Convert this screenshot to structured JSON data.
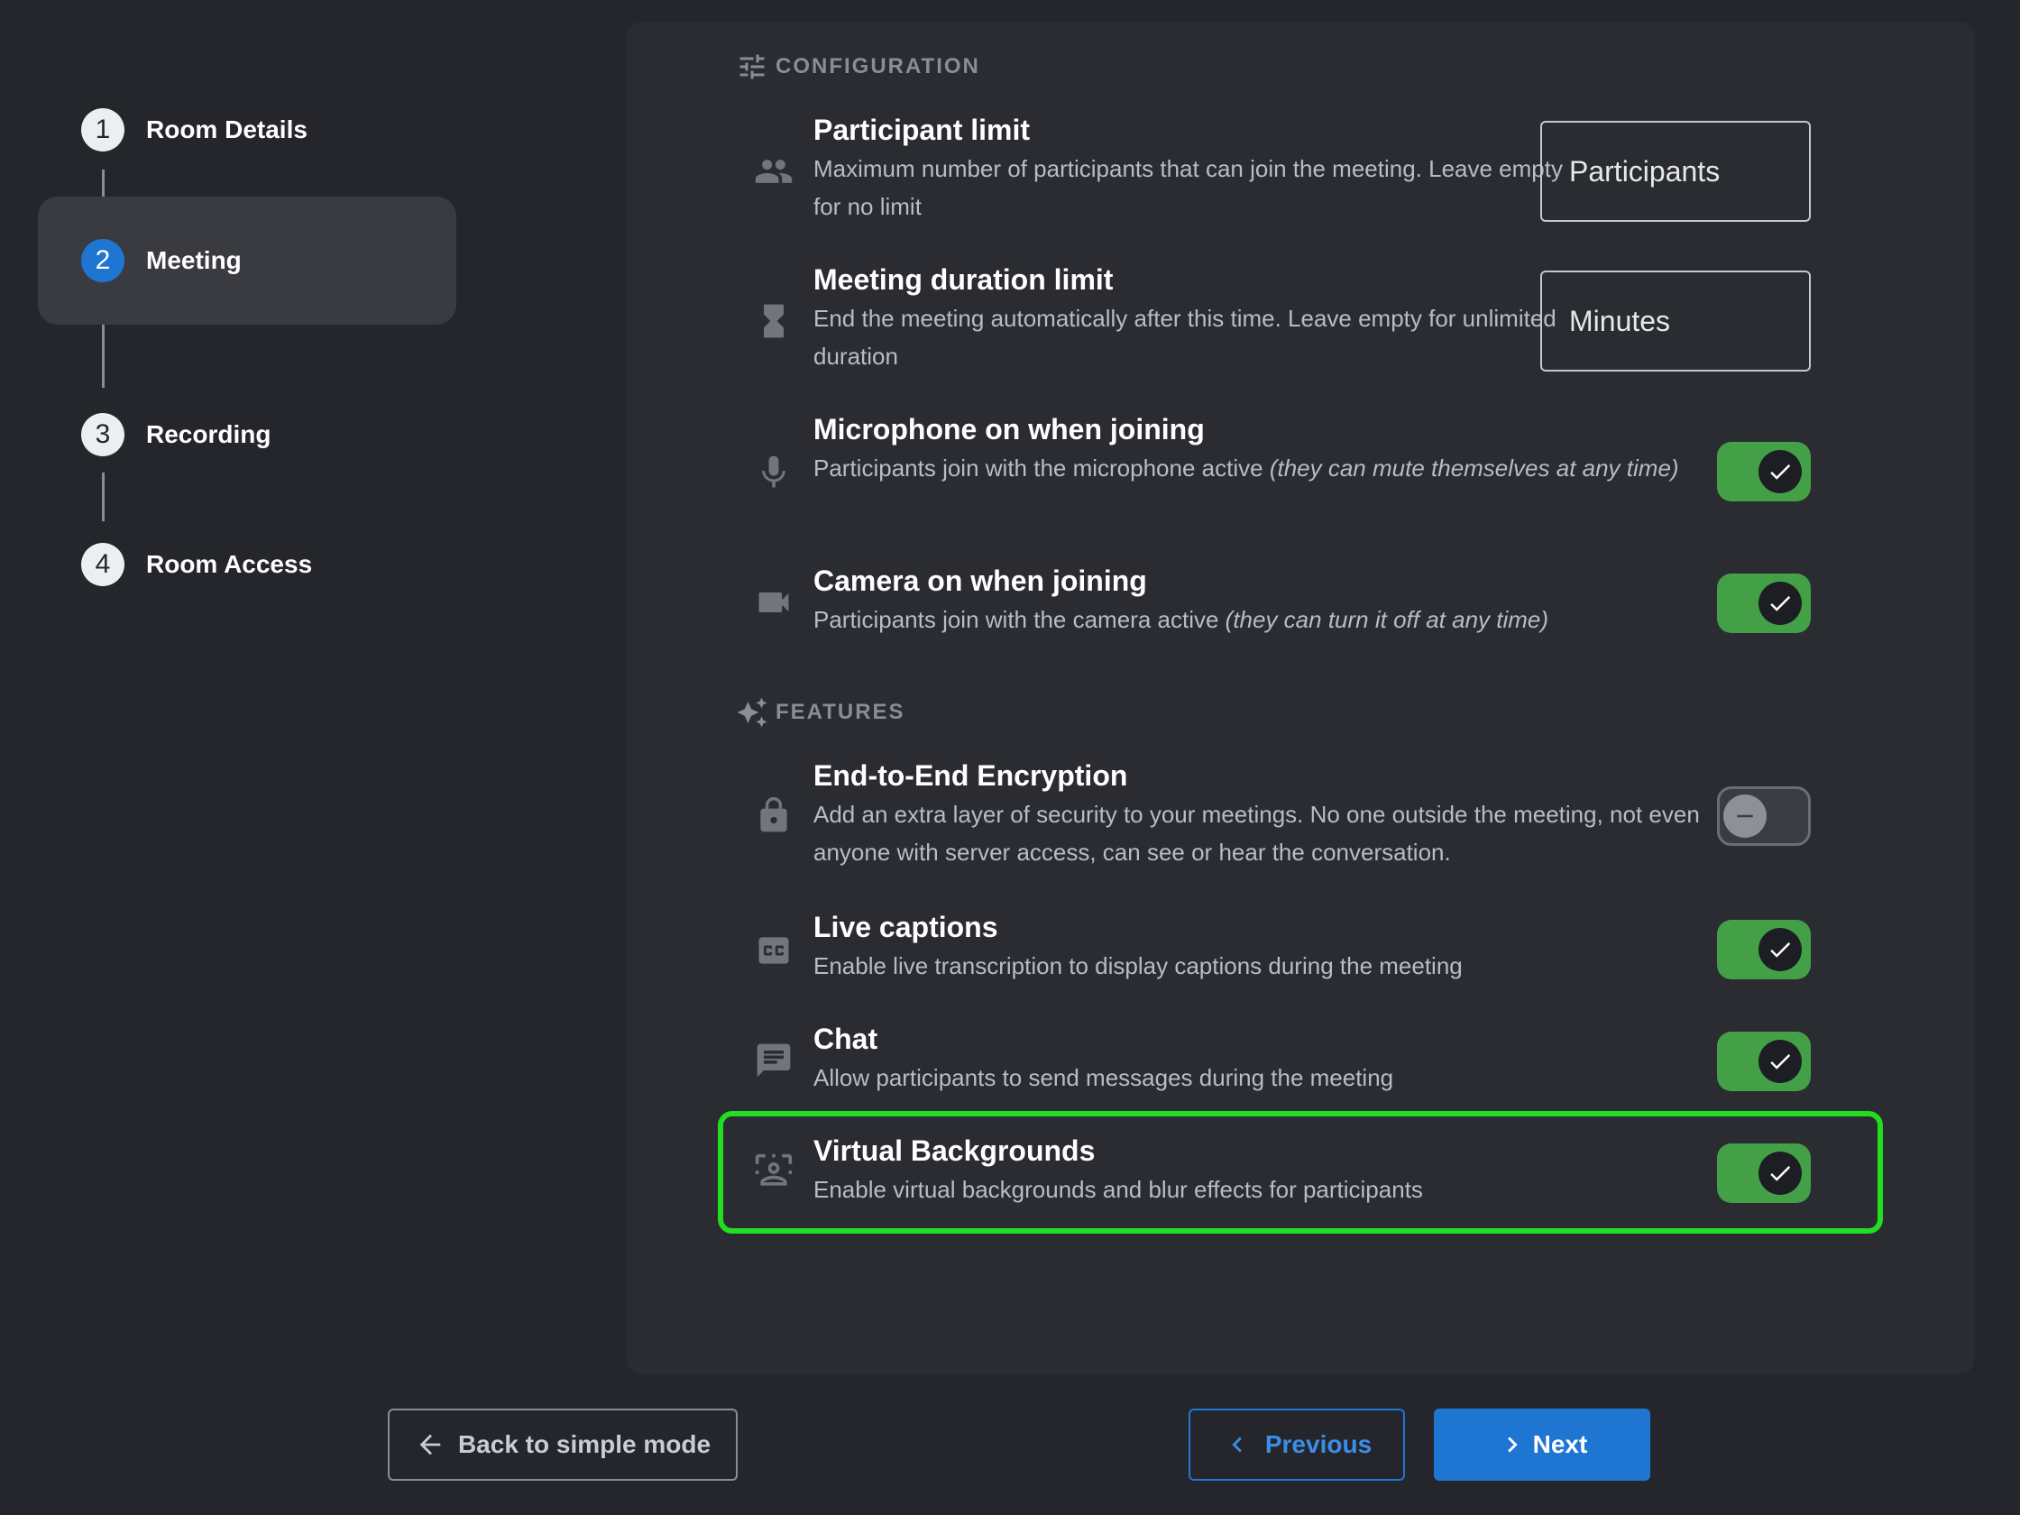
{
  "stepper": {
    "steps": [
      {
        "number": "1",
        "label": "Room Details"
      },
      {
        "number": "2",
        "label": "Meeting"
      },
      {
        "number": "3",
        "label": "Recording"
      },
      {
        "number": "4",
        "label": "Room Access"
      }
    ],
    "active_step": 2
  },
  "configuration": {
    "header": "CONFIGURATION",
    "participant_limit": {
      "title": "Participant limit",
      "desc": "Maximum number of participants that can join the meeting. Leave empty for no limit",
      "placeholder": "Participants"
    },
    "duration_limit": {
      "title": "Meeting duration limit",
      "desc": "End the meeting automatically after this time. Leave empty for unlimited duration",
      "placeholder": "Minutes"
    },
    "microphone": {
      "title": "Microphone on when joining",
      "desc": "Participants join with the microphone active ",
      "desc_italic": "(they can mute themselves at any time)",
      "enabled": true
    },
    "camera": {
      "title": "Camera on when joining",
      "desc": "Participants join with the camera active ",
      "desc_italic": "(they can turn it off at any time)",
      "enabled": true
    }
  },
  "features": {
    "header": "FEATURES",
    "e2ee": {
      "title": "End-to-End Encryption",
      "desc": "Add an extra layer of security to your meetings. No one outside the meeting, not even anyone with server access, can see or hear the conversation.",
      "enabled": false
    },
    "captions": {
      "title": "Live captions",
      "desc": "Enable live transcription to display captions during the meeting",
      "enabled": true
    },
    "chat": {
      "title": "Chat",
      "desc": "Allow participants to send messages during the meeting",
      "enabled": true
    },
    "virtual_backgrounds": {
      "title": "Virtual Backgrounds",
      "desc": "Enable virtual backgrounds and blur effects for participants",
      "enabled": true
    }
  },
  "footer": {
    "back_label": "Back to simple mode",
    "previous_label": "Previous",
    "next_label": "Next"
  },
  "colors": {
    "background": "#25262c",
    "card": "#2b2c32",
    "accent": "#1f76d2",
    "toggle_on": "#43a047",
    "highlight": "#22dd22"
  }
}
